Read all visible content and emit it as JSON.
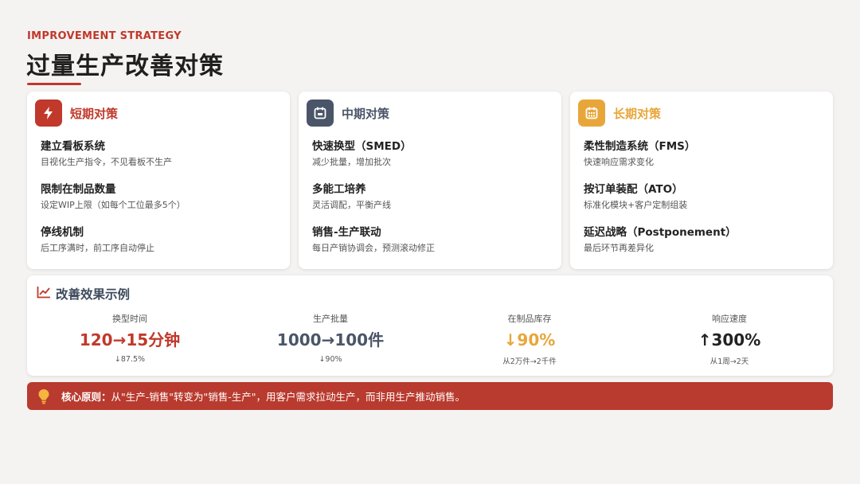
{
  "header": {
    "eyebrow": "IMPROVEMENT STRATEGY",
    "title": "过量生产改善对策"
  },
  "colors": {
    "accent_red": "#c0392b",
    "slate": "#4a5568",
    "amber": "#e8a63a"
  },
  "strategies": [
    {
      "title": "短期对策",
      "icon": "lightning-icon",
      "color": "#c0392b",
      "items": [
        {
          "title": "建立看板系统",
          "desc": "目视化生产指令，不见看板不生产"
        },
        {
          "title": "限制在制品数量",
          "desc": "设定WIP上限（如每个工位最多5个）"
        },
        {
          "title": "停线机制",
          "desc": "后工序满时，前工序自动停止"
        }
      ]
    },
    {
      "title": "中期对策",
      "icon": "calendar-icon",
      "color": "#4a5568",
      "items": [
        {
          "title": "快速换型（SMED）",
          "desc": "减少批量，增加批次"
        },
        {
          "title": "多能工培养",
          "desc": "灵活调配，平衡产线"
        },
        {
          "title": "销售-生产联动",
          "desc": "每日产销协调会，预测滚动修正"
        }
      ]
    },
    {
      "title": "长期对策",
      "icon": "calendar-grid-icon",
      "color": "#e8a63a",
      "items": [
        {
          "title": "柔性制造系统（FMS）",
          "desc": "快速响应需求变化"
        },
        {
          "title": "按订单装配（ATO）",
          "desc": "标准化模块+客户定制组装"
        },
        {
          "title": "延迟战略（Postponement）",
          "desc": "最后环节再差异化"
        }
      ]
    }
  ],
  "results": {
    "title": "改善效果示例",
    "icon": "line-chart-icon",
    "metrics": [
      {
        "label": "换型时间",
        "value": "120→15分钟",
        "sub": "↓87.5%",
        "color": "#c0392b"
      },
      {
        "label": "生产批量",
        "value": "1000→100件",
        "sub": "↓90%",
        "color": "#4a5568"
      },
      {
        "label": "在制品库存",
        "value": "↓90%",
        "sub": "从2万件→2千件",
        "color": "#e8a63a"
      },
      {
        "label": "响应速度",
        "value": "↑300%",
        "sub": "从1周→2天",
        "color": "#222222"
      }
    ]
  },
  "principle": {
    "icon": "lightbulb-icon",
    "label": "核心原则：",
    "text": "从\"生产-销售\"转变为\"销售-生产\"，用客户需求拉动生产，而非用生产推动销售。"
  }
}
